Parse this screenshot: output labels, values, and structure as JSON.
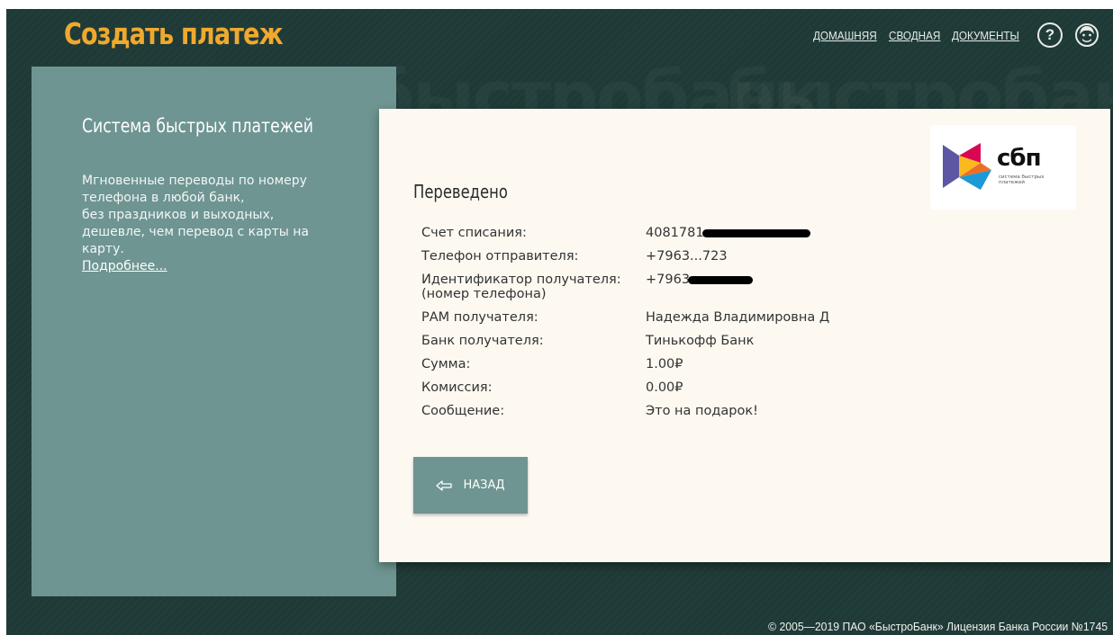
{
  "header": {
    "title": "Создать платеж",
    "watermark": "быстробанк",
    "nav": [
      {
        "label": "ДОМАШНЯЯ"
      },
      {
        "label": "СВОДНАЯ"
      },
      {
        "label": "ДОКУМЕНТЫ"
      }
    ],
    "help_glyph": "?",
    "icons": {
      "help": "help-circle-icon",
      "user": "user-avatar-icon"
    }
  },
  "sidebar": {
    "title": "Система быстрых платежей",
    "lines": [
      "Мгновенные переводы по номеру",
      "телефона в любой банк,",
      "без праздников и выходных,",
      "дешевле, чем перевод с карты на",
      "карту."
    ],
    "more_link": "Подробнее..."
  },
  "card": {
    "logo": {
      "text": "сбп",
      "subtitle": "система быстрых платежей"
    },
    "status": "Переведено",
    "rows": [
      {
        "label": "Счет списания:",
        "value": "4081781",
        "masked": true
      },
      {
        "label": "Телефон отправителя:",
        "value": "+7963...723",
        "masked": false
      },
      {
        "label": "Идентификатор получателя: (номер телефона)",
        "value": "+7963",
        "masked": true
      },
      {
        "label": "РАМ получателя:",
        "value": "Надежда Владимировна Д",
        "masked": false
      },
      {
        "label": "Банк получателя:",
        "value": "Тинькофф Банк",
        "masked": false
      },
      {
        "label": "Сумма:",
        "value": "1.00₽",
        "masked": false
      },
      {
        "label": "Комиссия:",
        "value": "0.00₽",
        "masked": false
      },
      {
        "label": "Сообщение:",
        "value": "Это на подарок!",
        "masked": false
      }
    ],
    "back_button": "НАЗАД"
  },
  "footer": {
    "text": "© 2005—2019 ПАО «БыстроБанк» Лицензия Банка России №1745"
  },
  "colors": {
    "background": "#1f3a36",
    "accent": "#f0a92e",
    "panel": "#6e9591",
    "card": "#fdf9f1"
  }
}
